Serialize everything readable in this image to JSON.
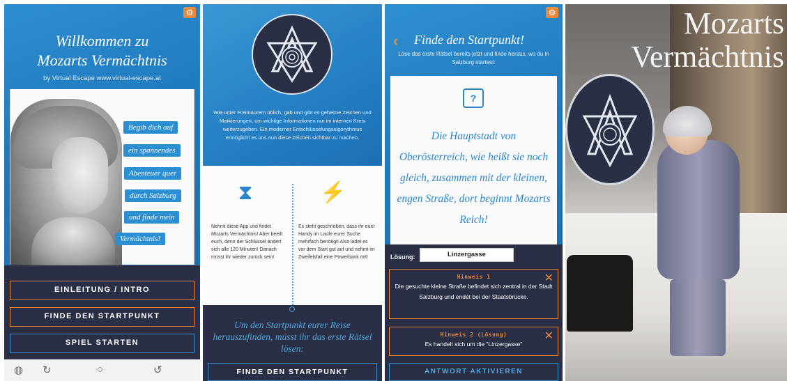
{
  "screen1": {
    "settings_icon": "gear-icon",
    "title_line1": "Willkommen zu",
    "title_line2": "Mozarts Vermächtnis",
    "byline": "by Virtual Escape www.virtual-escape.at",
    "bubbles": [
      "Begib dich auf",
      "ein spannendes",
      "Abenteuer quer",
      "durch Salzburg",
      "und finde mein",
      "Vermächtnis!"
    ],
    "buttons": {
      "intro": "EINLEITUNG / INTRO",
      "startpoint": "FINDE DEN STARTPUNKT",
      "start_game": "SPIEL STARTEN"
    },
    "colors": {
      "accent": "#e8893b",
      "blue": "#2b8fd1",
      "dark": "#2b2f45"
    }
  },
  "screen2": {
    "intro_text": "Wie unter Freimaurern üblich, gab und gibt es geheime Zeichen und Markierungen, um wichtige Informationen nur im internen Kreis weiterzugeben. Ein moderner Entschlüsselungsalgorythmus ermöglicht es uns nun diese Zeichen sichtbar zu machen.",
    "left_icon": "hourglass-icon",
    "right_icon": "powerbank-icon",
    "left_text": "Nehmt diese App und findet Mozarts Vermächtnis! Aber beeilt euch, denn der Schlüssel ändert sich alle 120 Minuten! Danach müsst ihr wieder zurück sein!",
    "right_text": "Es steht geschrieben, dass ihr euer Handy im Laufe eurer Suche mehrfach benötigt! Also ladet es vor dem Start gut auf und nehmt im Zweifelsfall eine Powerbank mit!",
    "cta_text": "Um den Startpunkt eurer Reise herauszufinden, müsst ihr das erste Rätsel lösen:",
    "button": "FINDE DEN STARTPUNKT"
  },
  "screen3": {
    "back_icon": "chevron-left-icon",
    "title": "Finde den Startpunkt!",
    "subtitle": "Löse das erste Rätsel bereits jetzt und finde heraus, wo du in Salzburg startest:",
    "riddle_icon": "scroll-question-icon",
    "riddle_icon_glyph": "?",
    "riddle": "Die Hauptstadt von Oberösterreich, wie heißt sie noch gleich, zusammen mit der kleinen, engen Straße, dort beginnt Mozarts Reich!",
    "solution_label": "Lösung:",
    "solution_value": "Linzergasse",
    "hint1_title": "Hinweis 1",
    "hint1_text": "Die gesuchte kleine Straße befindet sich zentral in der Stadt Salzburg und endet bei der Staatsbrücke.",
    "hint2_title": "Hinweis 2 (Lösung)",
    "hint2_text": "Es handelt sich um die \"Linzergasse\"",
    "close_glyph": "✕",
    "button": "ANTWORT AKTIVIEREN"
  },
  "screen4": {
    "title_line1": "Mozarts",
    "title_line2": "Vermächtnis"
  }
}
